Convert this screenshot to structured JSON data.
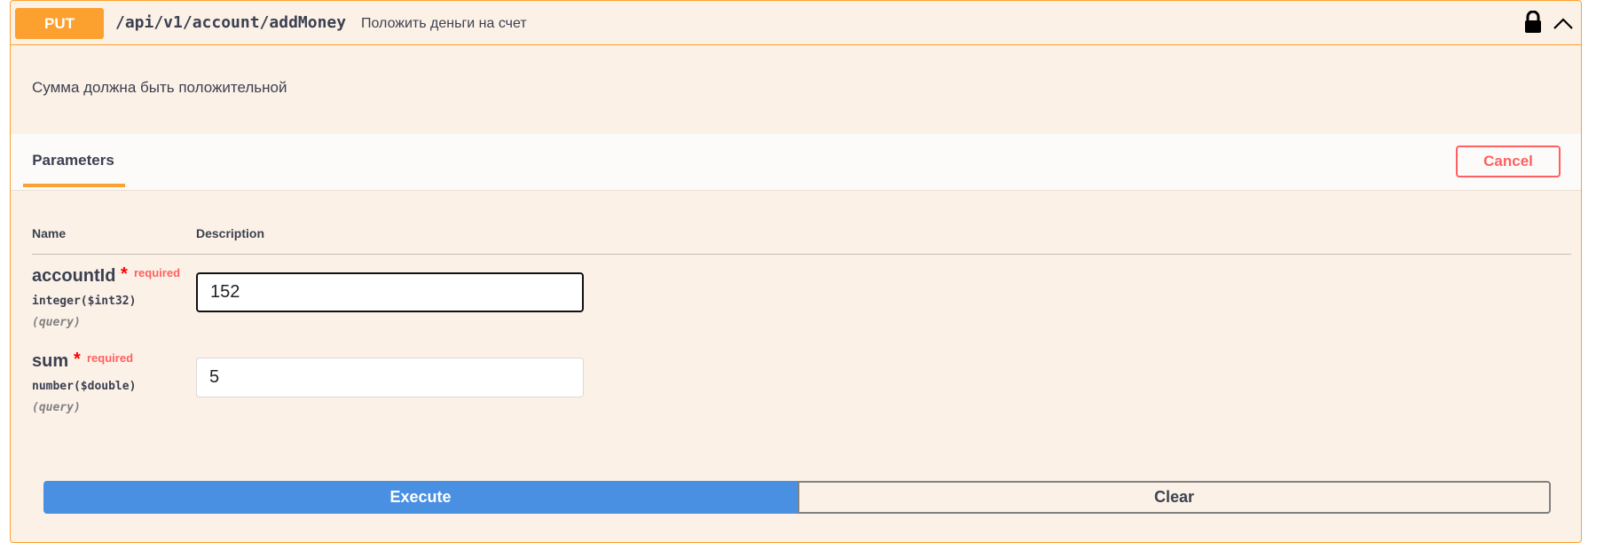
{
  "operation": {
    "method": "PUT",
    "path": "/api/v1/account/addMoney",
    "summary": "Положить деньги на счет",
    "description": "Сумма должна быть положительной",
    "icons": {
      "lock": "lock-icon",
      "collapse": "chevron-up-icon"
    },
    "colors": {
      "method": "#fca130",
      "background": "#fcf1e7",
      "execute": "#4990e2",
      "cancel": "#ff6060"
    }
  },
  "parameters": {
    "tab_label": "Parameters",
    "cancel_label": "Cancel",
    "col_name": "Name",
    "col_description": "Description",
    "items": [
      {
        "name": "accountId",
        "star": "*",
        "required": "required",
        "type": "integer",
        "format": "($int32)",
        "in": "(query)",
        "value": "152"
      },
      {
        "name": "sum",
        "star": "*",
        "required": "required",
        "type": "number",
        "format": "($double)",
        "in": "(query)",
        "value": "5"
      }
    ]
  },
  "actions": {
    "execute_label": "Execute",
    "clear_label": "Clear"
  }
}
